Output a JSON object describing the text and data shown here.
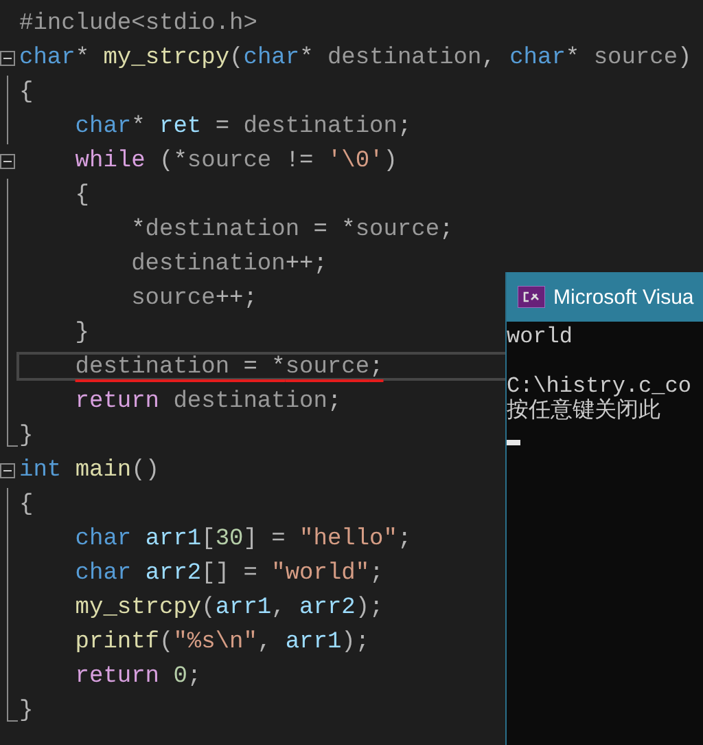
{
  "editor": {
    "lines": [
      {
        "kind": "plain",
        "tokens": [
          {
            "kind": "macro",
            "text": "#include<stdio.h>"
          }
        ]
      },
      {
        "kind": "fold",
        "tokens": [
          {
            "kind": "type",
            "text": "char"
          },
          {
            "kind": "punct",
            "text": "* "
          },
          {
            "kind": "func",
            "text": "my_strcpy"
          },
          {
            "kind": "punct",
            "text": "("
          },
          {
            "kind": "type",
            "text": "char"
          },
          {
            "kind": "punct",
            "text": "* "
          },
          {
            "kind": "param",
            "text": "destination"
          },
          {
            "kind": "punct",
            "text": ", "
          },
          {
            "kind": "type",
            "text": "char"
          },
          {
            "kind": "punct",
            "text": "* "
          },
          {
            "kind": "param",
            "text": "source"
          },
          {
            "kind": "punct",
            "text": ")"
          }
        ]
      },
      {
        "kind": "line",
        "tokens": [
          {
            "kind": "punct",
            "text": "{"
          }
        ],
        "children": [
          {
            "kind": "line",
            "tokens": [
              {
                "kind": "type",
                "text": "char"
              },
              {
                "kind": "punct",
                "text": "* "
              },
              {
                "kind": "local",
                "text": "ret"
              },
              {
                "kind": "punct",
                "text": " = "
              },
              {
                "kind": "param",
                "text": "destination"
              },
              {
                "kind": "punct",
                "text": ";"
              }
            ]
          },
          {
            "kind": "fold",
            "tokens": [
              {
                "kind": "keyword",
                "text": "while"
              },
              {
                "kind": "punct",
                "text": " (*"
              },
              {
                "kind": "param",
                "text": "source"
              },
              {
                "kind": "punct",
                "text": " != "
              },
              {
                "kind": "string",
                "text": "'\\0'"
              },
              {
                "kind": "punct",
                "text": ")"
              }
            ]
          },
          {
            "kind": "line",
            "tokens": [
              {
                "kind": "punct",
                "text": "{"
              }
            ],
            "children": [
              {
                "kind": "line",
                "tokens": [
                  {
                    "kind": "punct",
                    "text": "*"
                  },
                  {
                    "kind": "param",
                    "text": "destination"
                  },
                  {
                    "kind": "punct",
                    "text": " = *"
                  },
                  {
                    "kind": "param",
                    "text": "source"
                  },
                  {
                    "kind": "punct",
                    "text": ";"
                  }
                ]
              },
              {
                "kind": "line",
                "tokens": [
                  {
                    "kind": "param",
                    "text": "destination"
                  },
                  {
                    "kind": "punct",
                    "text": "++;"
                  }
                ]
              },
              {
                "kind": "line",
                "tokens": [
                  {
                    "kind": "param",
                    "text": "source"
                  },
                  {
                    "kind": "punct",
                    "text": "++;"
                  }
                ]
              }
            ]
          },
          {
            "kind": "line",
            "tokens": [
              {
                "kind": "punct",
                "text": "}"
              }
            ]
          },
          {
            "kind": "line",
            "current": true,
            "underlined": true,
            "tokens": [
              {
                "kind": "param",
                "text": "destination"
              },
              {
                "kind": "punct",
                "text": " = *"
              },
              {
                "kind": "param",
                "text": "source"
              },
              {
                "kind": "punct",
                "text": ";"
              }
            ]
          },
          {
            "kind": "line",
            "tokens": [
              {
                "kind": "keyword",
                "text": "return "
              },
              {
                "kind": "param",
                "text": "destination"
              },
              {
                "kind": "punct",
                "text": ";"
              }
            ]
          }
        ]
      },
      {
        "kind": "end",
        "tokens": [
          {
            "kind": "punct",
            "text": "}"
          }
        ]
      },
      {
        "kind": "fold",
        "tokens": [
          {
            "kind": "type",
            "text": "int "
          },
          {
            "kind": "func",
            "text": "main"
          },
          {
            "kind": "punct",
            "text": "()"
          }
        ]
      },
      {
        "kind": "line",
        "tokens": [
          {
            "kind": "punct",
            "text": "{"
          }
        ],
        "children": [
          {
            "kind": "line",
            "tokens": [
              {
                "kind": "type",
                "text": "char "
              },
              {
                "kind": "local",
                "text": "arr1"
              },
              {
                "kind": "punct",
                "text": "["
              },
              {
                "kind": "number",
                "text": "30"
              },
              {
                "kind": "punct",
                "text": "] = "
              },
              {
                "kind": "string",
                "text": "\"hello\""
              },
              {
                "kind": "punct",
                "text": ";"
              }
            ]
          },
          {
            "kind": "line",
            "tokens": [
              {
                "kind": "type",
                "text": "char "
              },
              {
                "kind": "local",
                "text": "arr2"
              },
              {
                "kind": "punct",
                "text": "[] = "
              },
              {
                "kind": "string",
                "text": "\"world\""
              },
              {
                "kind": "punct",
                "text": ";"
              }
            ]
          },
          {
            "kind": "line",
            "tokens": [
              {
                "kind": "func",
                "text": "my_strcpy"
              },
              {
                "kind": "punct",
                "text": "("
              },
              {
                "kind": "local",
                "text": "arr1"
              },
              {
                "kind": "punct",
                "text": ", "
              },
              {
                "kind": "local",
                "text": "arr2"
              },
              {
                "kind": "punct",
                "text": ");"
              }
            ]
          },
          {
            "kind": "line",
            "tokens": [
              {
                "kind": "func",
                "text": "printf"
              },
              {
                "kind": "punct",
                "text": "("
              },
              {
                "kind": "string",
                "text": "\"%s\\n\""
              },
              {
                "kind": "punct",
                "text": ", "
              },
              {
                "kind": "local",
                "text": "arr1"
              },
              {
                "kind": "punct",
                "text": ");"
              }
            ]
          },
          {
            "kind": "line",
            "tokens": [
              {
                "kind": "keyword",
                "text": "return "
              },
              {
                "kind": "number",
                "text": "0"
              },
              {
                "kind": "punct",
                "text": ";"
              }
            ]
          }
        ]
      },
      {
        "kind": "end",
        "tokens": [
          {
            "kind": "punct",
            "text": "}"
          }
        ]
      }
    ]
  },
  "console": {
    "title": "Microsoft Visua",
    "lines": [
      {
        "text": "world",
        "gap_before": false
      },
      {
        "text": "C:\\histry.c_co",
        "gap_before": true
      },
      {
        "text": "按任意键关闭此",
        "gap_before": false
      }
    ]
  }
}
